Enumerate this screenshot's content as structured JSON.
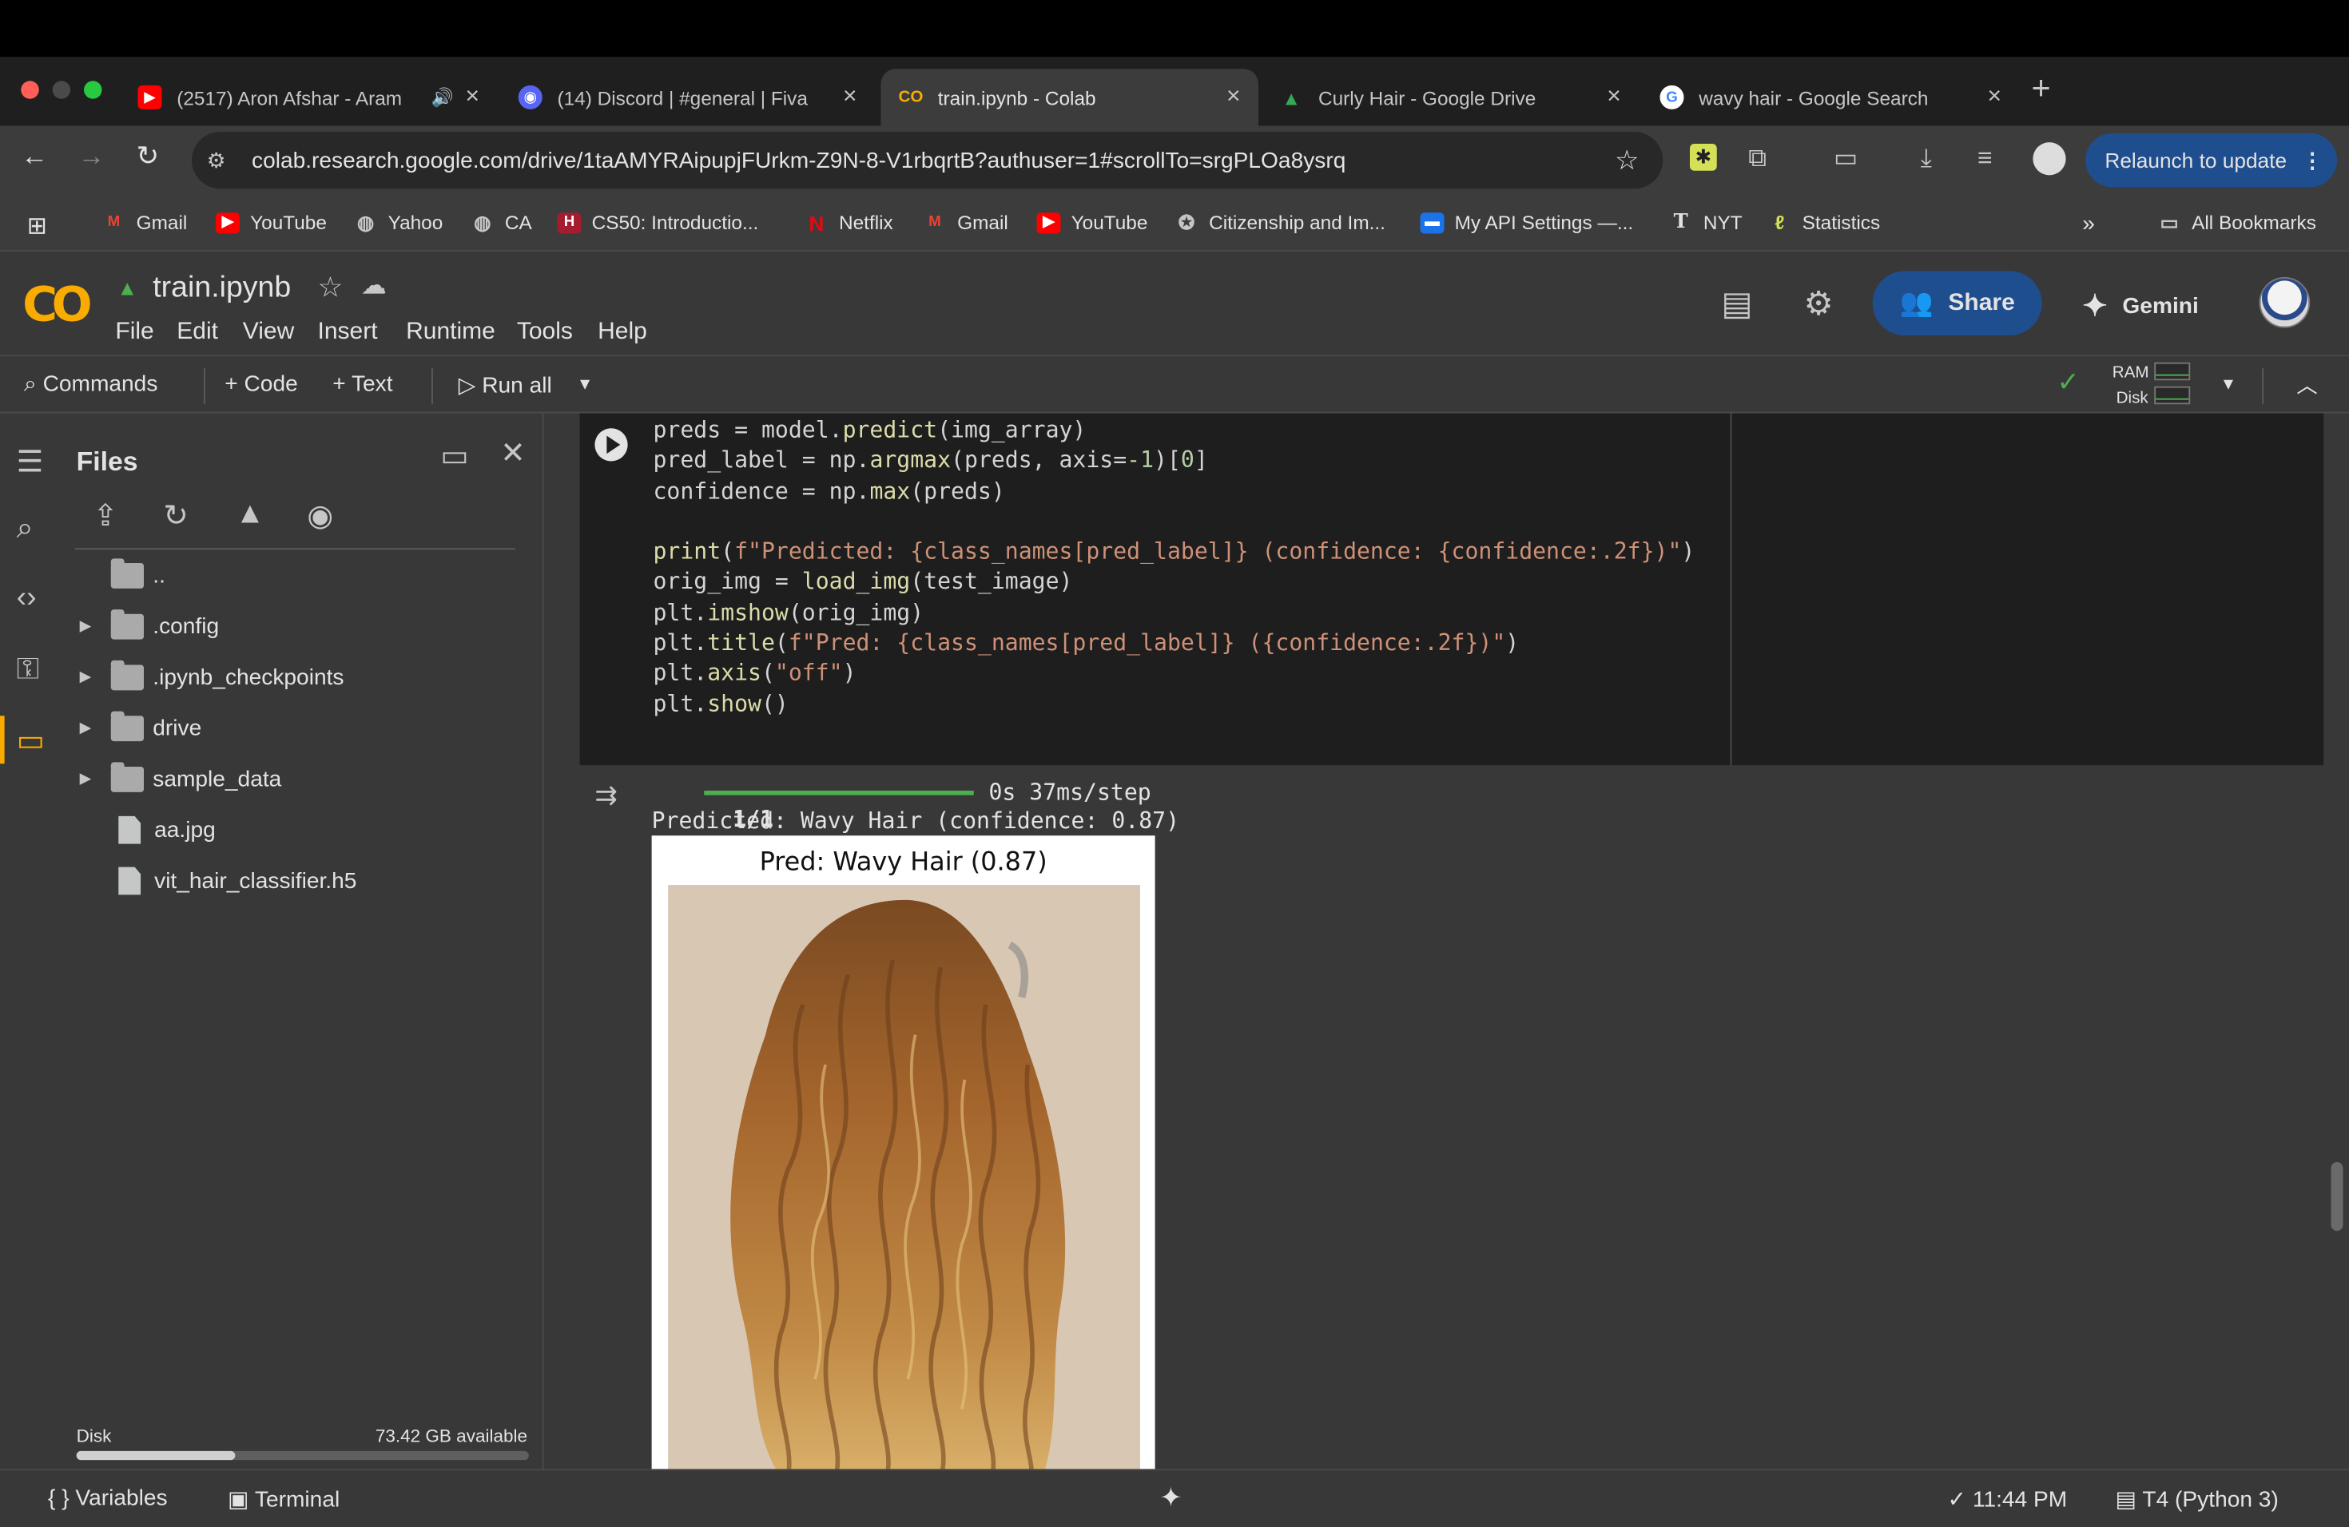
{
  "browser": {
    "tabs": [
      {
        "title": "(2517) Aron Afshar - Aram",
        "favicon": "youtube-icon",
        "audio": true
      },
      {
        "title": "(14) Discord | #general | Fiva",
        "favicon": "discord-icon",
        "badge": "14"
      },
      {
        "title": "train.ipynb - Colab",
        "favicon": "colab-icon",
        "active": true
      },
      {
        "title": "Curly Hair - Google Drive",
        "favicon": "google-drive-icon"
      },
      {
        "title": "wavy hair - Google Search",
        "favicon": "google-icon"
      }
    ],
    "url": "colab.research.google.com/drive/1taAMYRAipupjFUrkm-Z9N-8-V1rbqrtB?authuser=1#scrollTo=srgPLOa8ysrq",
    "relaunch_label": "Relaunch to update",
    "bookmarks": [
      {
        "label": "Gmail",
        "icon": "gmail-icon"
      },
      {
        "label": "YouTube",
        "icon": "youtube-icon"
      },
      {
        "label": "Yahoo",
        "icon": "globe-icon"
      },
      {
        "label": "CA",
        "icon": "globe-icon"
      },
      {
        "label": "CS50: Introductio...",
        "icon": "harvard-icon"
      },
      {
        "label": "Netflix",
        "icon": "netflix-icon"
      },
      {
        "label": "Gmail",
        "icon": "gmail-icon"
      },
      {
        "label": "YouTube",
        "icon": "youtube-icon"
      },
      {
        "label": "Citizenship and Im...",
        "icon": "seal-icon"
      },
      {
        "label": "My API Settings —...",
        "icon": "api-icon"
      },
      {
        "label": "NYT",
        "icon": "nyt-icon"
      },
      {
        "label": "Statistics",
        "icon": "statistics-icon"
      }
    ],
    "all_bookmarks_label": "All Bookmarks",
    "colors": {
      "accent": "#1f4e8f",
      "tab_bg": "#1f1f1f",
      "toolbar_bg": "#3c3c3c"
    }
  },
  "colab": {
    "logo_text": "CO",
    "notebook_title": "train.ipynb",
    "menu": [
      "File",
      "Edit",
      "View",
      "Insert",
      "Runtime",
      "Tools",
      "Help"
    ],
    "share_label": "Share",
    "gemini_label": "Gemini",
    "toolbar": {
      "commands": "Commands",
      "code": "+ Code",
      "text": "+ Text",
      "run_all": "Run all",
      "ram_label": "RAM",
      "disk_label": "Disk"
    },
    "files": {
      "header": "Files",
      "items": [
        {
          "name": "..",
          "type": "parent"
        },
        {
          "name": ".config",
          "type": "folder"
        },
        {
          "name": ".ipynb_checkpoints",
          "type": "folder"
        },
        {
          "name": "drive",
          "type": "folder"
        },
        {
          "name": "sample_data",
          "type": "folder"
        },
        {
          "name": "aa.jpg",
          "type": "file"
        },
        {
          "name": "vit_hair_classifier.h5",
          "type": "file"
        }
      ],
      "disk_label": "Disk",
      "disk_available": "73.42 GB available",
      "disk_used_fraction": 0.35
    },
    "cell": {
      "code_lines": [
        "preds = model.predict(img_array)",
        "pred_label = np.argmax(preds, axis=-1)[0]",
        "confidence = np.max(preds)",
        "",
        "print(f\"Predicted: {class_names[pred_label]} (confidence: {confidence:.2f})\")",
        "orig_img = load_img(test_image)",
        "plt.imshow(orig_img)",
        "plt.title(f\"Pred: {class_names[pred_label]} ({confidence:.2f})\")",
        "plt.axis(\"off\")",
        "plt.show()"
      ],
      "output": {
        "progress_step": "1/1",
        "progress_fraction": 1.0,
        "progress_time": "0s 37ms/step",
        "prediction_line": "Predicted: Wavy Hair (confidence: 0.87)",
        "figure_title": "Pred: Wavy Hair (0.87)"
      }
    },
    "status": {
      "variables": "Variables",
      "terminal": "Terminal",
      "time": "11:44 PM",
      "runtime": "T4 (Python 3)"
    }
  }
}
